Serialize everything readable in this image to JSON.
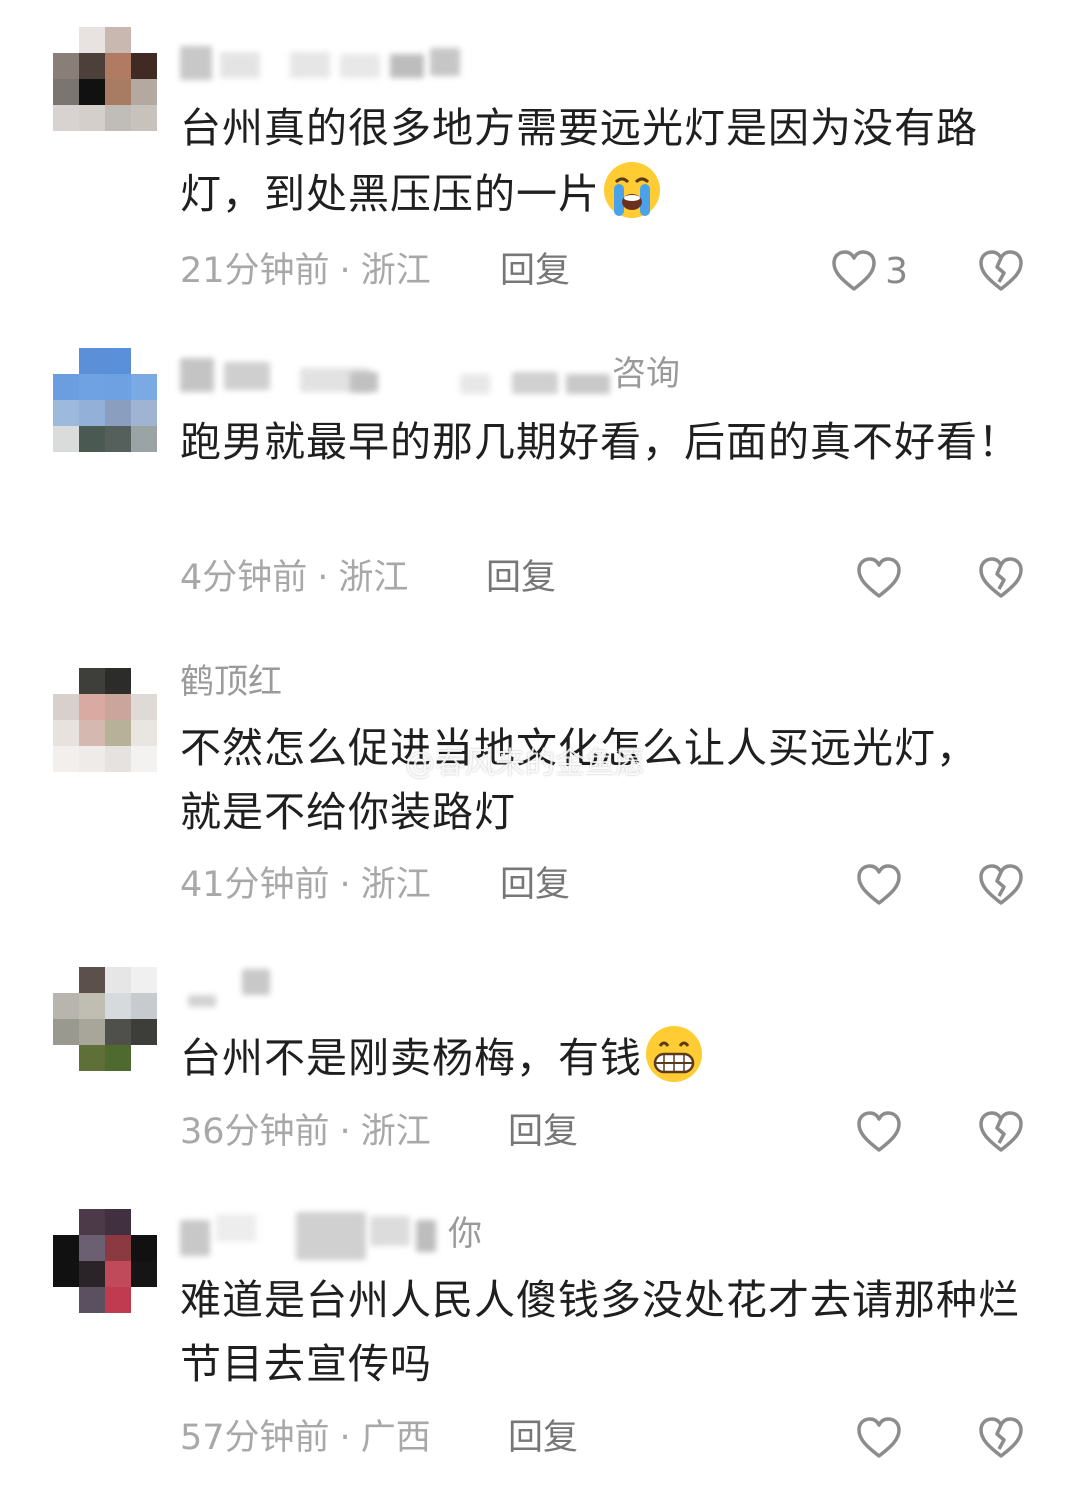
{
  "comments": [
    {
      "name_visible": "",
      "text": "台州真的很多地方需要远光灯是因为没有路灯，到处黑压压的一片",
      "emoji": "loudly-crying-face",
      "time": "21分钟前",
      "location": "浙江",
      "reply_label": "回复",
      "likes": "3",
      "avatar_colors": [
        "#ffffff",
        "#e8e2e0",
        "#c9b8b0",
        "#ffffff",
        "#8a7f78",
        "#4d3f3a",
        "#b07b62",
        "#3f2a24",
        "#7a7570",
        "#111111",
        "#a87b63",
        "#b3a9a0",
        "#d8d3d0",
        "#d5cfcc",
        "#c0bcb8",
        "#c8c2bd"
      ]
    },
    {
      "name_visible": "咨询",
      "text": "跑男就最早的那几期好看，后面的真不好看！",
      "emoji": "",
      "time": "4分钟前",
      "location": "浙江",
      "reply_label": "回复",
      "likes": "",
      "avatar_colors": [
        "#ffffff",
        "#5b8fd8",
        "#5a8fd9",
        "#ffffff",
        "#6a9ee0",
        "#6fa2e3",
        "#6ea1e2",
        "#7aa9e4",
        "#9db9dc",
        "#92b0d8",
        "#8a9fc0",
        "#9fb4d0",
        "#d9dcdb",
        "#4a5a52",
        "#55605c",
        "#9aa4a4"
      ]
    },
    {
      "name_visible": "鹤顶红",
      "text": "不然怎么促进当地文化怎么让人买远光灯，就是不给你装路灯",
      "emoji": "",
      "time": "41分钟前",
      "location": "浙江",
      "reply_label": "回复",
      "likes": "",
      "avatar_colors": [
        "#ffffff",
        "#3e3e3a",
        "#2c2c2a",
        "#ffffff",
        "#d8d0cc",
        "#d8aaa2",
        "#c9a59c",
        "#e0dad6",
        "#e8e2df",
        "#d5b8b0",
        "#b7b19a",
        "#e9e6e2",
        "#f2efed",
        "#efebe8",
        "#e5e2df",
        "#f4f2f0"
      ]
    },
    {
      "name_visible": "",
      "text": "台州不是刚卖杨梅，有钱",
      "emoji": "grinning-face",
      "time": "36分钟前",
      "location": "浙江",
      "reply_label": "回复",
      "likes": "",
      "avatar_colors": [
        "#ffffff",
        "#5c504c",
        "#e6e6e6",
        "#f0f0f0",
        "#b7b5ad",
        "#c0bdb3",
        "#d7dadd",
        "#c7cace",
        "#9a9990",
        "#a8a59a",
        "#4f4f4b",
        "#3d3d3a",
        "#ffffff",
        "#5e7038",
        "#4f6a2e",
        "#ffffff"
      ]
    },
    {
      "name_visible": "你",
      "text": "难道是台州人民人傻钱多没处花才去请那种烂节目去宣传吗",
      "emoji": "",
      "time": "57分钟前",
      "location": "广西",
      "reply_label": "回复",
      "likes": "",
      "avatar_colors": [
        "#ffffff",
        "#4c3a48",
        "#403040",
        "#ffffff",
        "#111111",
        "#6a6072",
        "#8a3a40",
        "#111111",
        "#111111",
        "#2a2328",
        "#c04a5a",
        "#151515",
        "#ffffff",
        "#5a5060",
        "#c03a50",
        "#ffffff"
      ]
    }
  ],
  "watermark": "@春风来的金鱼愿",
  "colors": {
    "text": "#1f1f1f",
    "meta": "#a8a8a8",
    "name": "#9a9a9a",
    "icon": "#8c8c8c"
  }
}
